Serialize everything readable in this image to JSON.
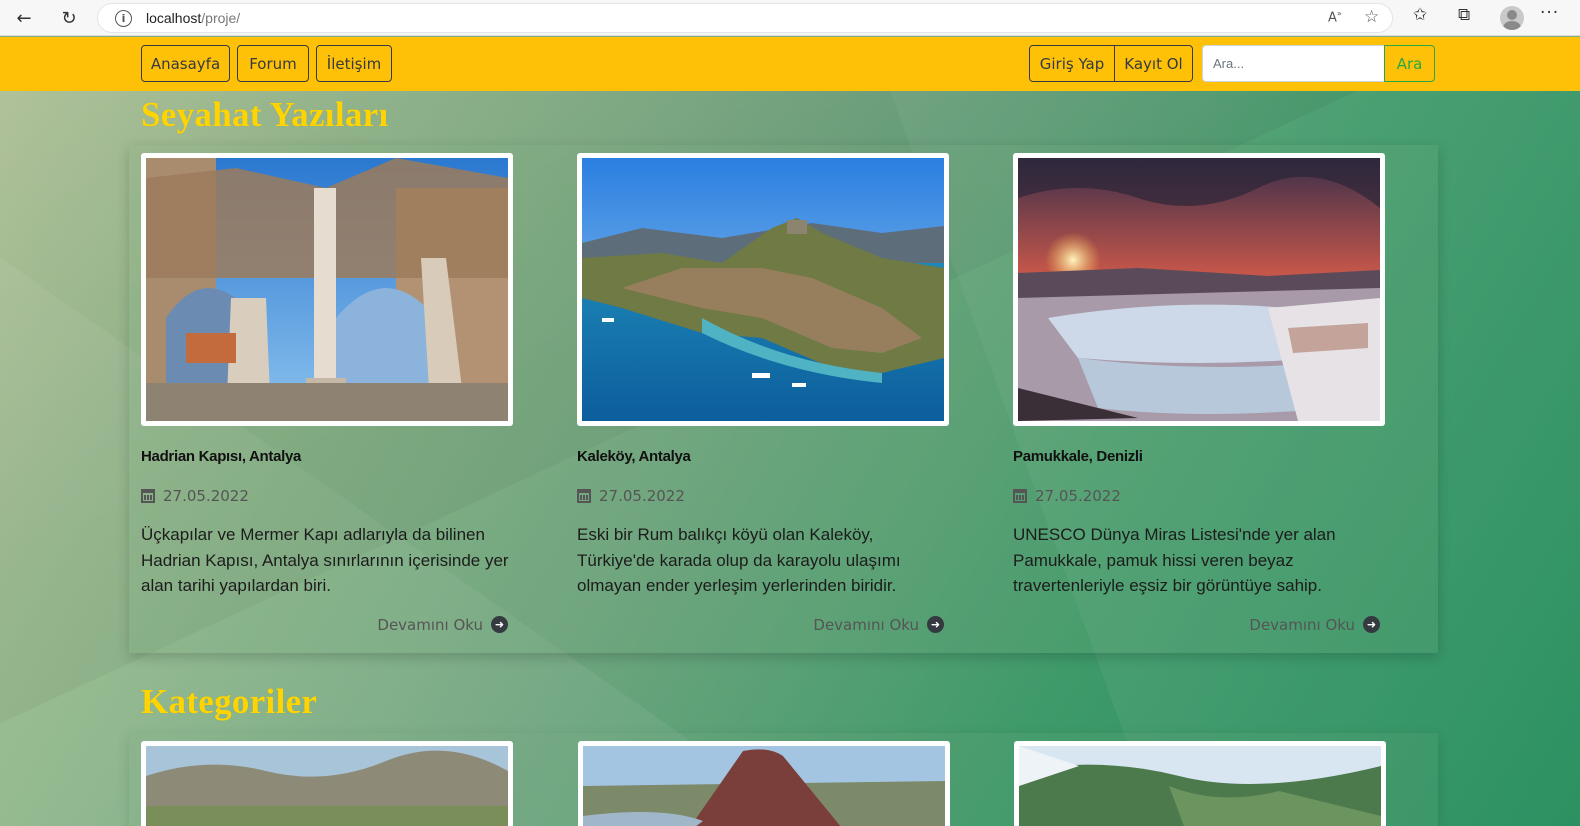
{
  "browser": {
    "url_host": "localhost",
    "url_path": "/proje/"
  },
  "navbar": {
    "home": "Anasayfa",
    "forum": "Forum",
    "contact": "İletişim",
    "login": "Giriş Yap",
    "register": "Kayıt Ol",
    "search_placeholder": "Ara...",
    "search_button": "Ara"
  },
  "sections": {
    "posts_title": "Seyahat Yazıları",
    "categories_title": "Kategoriler"
  },
  "posts": [
    {
      "title": "Hadrian Kapısı, Antalya",
      "date": "27.05.2022",
      "desc": "Üçkapılar ve Mermer Kapı adlarıyla da bilinen Hadrian Kapısı, Antalya sınırlarının içerisinde yer alan tarihi yapılardan biri.",
      "more": "Devamını Oku"
    },
    {
      "title": "Kaleköy, Antalya",
      "date": "27.05.2022",
      "desc": "Eski bir Rum balıkçı köyü olan Kaleköy, Türkiye'de karada olup da karayolu ulaşımı olmayan ender yerleşim yerlerinden biridir.",
      "more": "Devamını Oku"
    },
    {
      "title": "Pamukkale, Denizli",
      "date": "27.05.2022",
      "desc": "UNESCO Dünya Miras Listesi'nde yer alan Pamukkale, pamuk hissi veren beyaz travertenleriyle eşsiz bir görüntüye sahip.",
      "more": "Devamını Oku"
    }
  ],
  "colors": {
    "navbar": "#ffc107",
    "heading": "#ffd400",
    "search_accent": "#28a745"
  }
}
